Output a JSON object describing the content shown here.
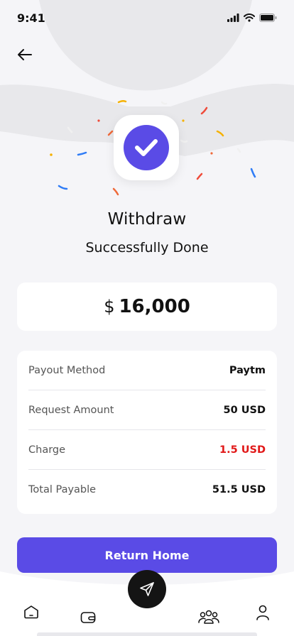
{
  "status_bar": {
    "time": "9:41"
  },
  "result": {
    "title": "Withdraw",
    "subtitle": "Successfully Done"
  },
  "amount": {
    "currency": "$",
    "value": "16,000"
  },
  "details": [
    {
      "label": "Payout Method",
      "value": "Paytm"
    },
    {
      "label": "Request Amount",
      "value": "50 USD"
    },
    {
      "label": "Charge",
      "value": "1.5 USD"
    },
    {
      "label": "Total Payable",
      "value": "51.5 USD"
    }
  ],
  "actions": {
    "return_label": "Return Home"
  },
  "colors": {
    "accent": "#5a4be6",
    "charge_red": "#e11818",
    "fab": "#141414"
  },
  "icons": {
    "back": "arrow-left-icon",
    "success": "checkmark-icon",
    "nav": [
      "home-icon",
      "wallet-icon",
      "send-icon",
      "community-icon",
      "profile-icon"
    ]
  }
}
